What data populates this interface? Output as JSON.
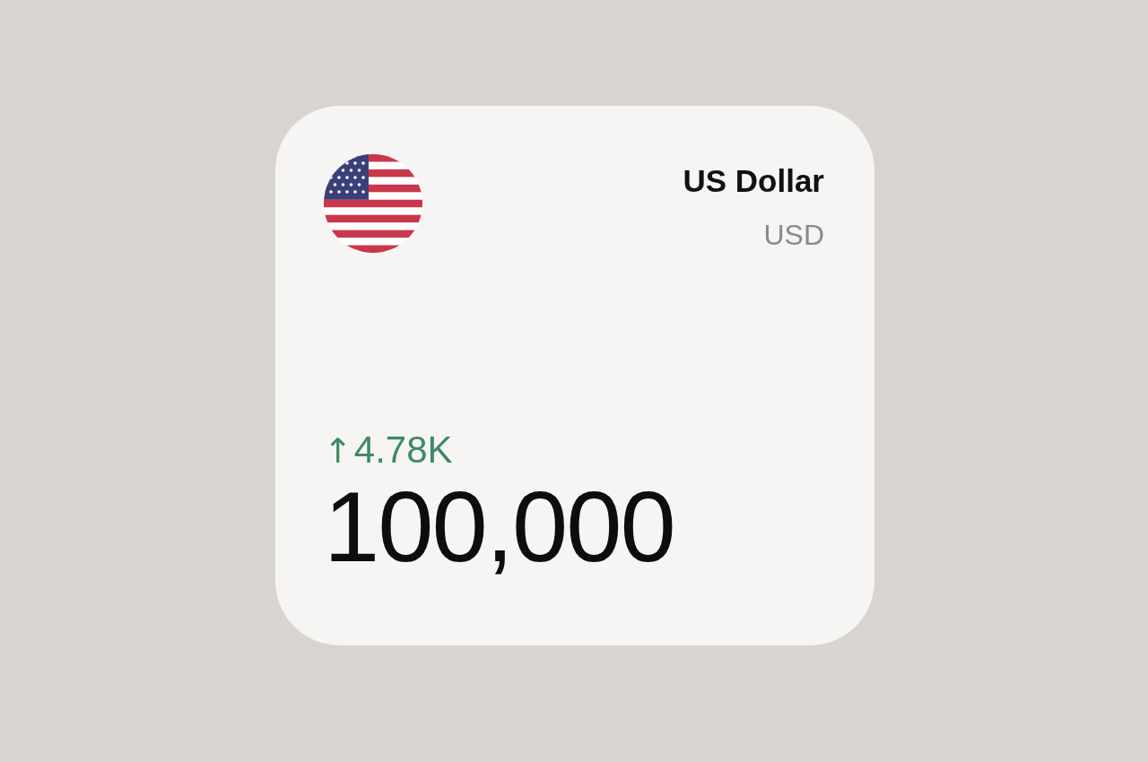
{
  "widget": {
    "currency_name": "US Dollar",
    "currency_code": "USD",
    "change": {
      "arrow": "↑",
      "value": "4.78K"
    },
    "amount": "100,000"
  }
}
